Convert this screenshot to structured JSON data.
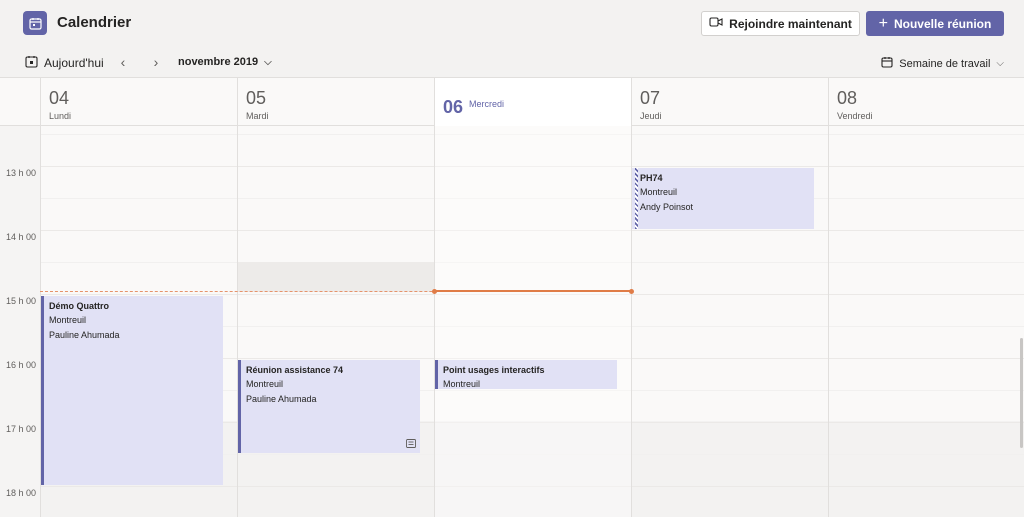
{
  "app": {
    "title": "Calendrier",
    "icon": "calendar-icon"
  },
  "header": {
    "join_label": "Rejoindre maintenant",
    "new_meeting_label": "Nouvelle réunion"
  },
  "toolbar": {
    "today_label": "Aujourd'hui",
    "month_label": "novembre 2019",
    "view_label": "Semaine de travail"
  },
  "days": [
    {
      "num": "04",
      "name": "Lundi"
    },
    {
      "num": "05",
      "name": "Mardi"
    },
    {
      "num": "06",
      "name": "Mercredi"
    },
    {
      "num": "07",
      "name": "Jeudi"
    },
    {
      "num": "08",
      "name": "Vendredi"
    }
  ],
  "times": [
    "13 h 00",
    "14 h 00",
    "15 h 00",
    "16 h 00",
    "17 h 00",
    "18 h 00"
  ],
  "events": {
    "demo": {
      "title": "Démo Quattro",
      "location": "Montreuil",
      "organizer": "Pauline Ahumada"
    },
    "reunion": {
      "title": "Réunion assistance 74",
      "location": "Montreuil",
      "organizer": "Pauline Ahumada"
    },
    "point": {
      "title": "Point usages interactifs",
      "location": "Montreuil"
    },
    "ph74": {
      "title": "PH74",
      "location": "Montreuil",
      "organizer": "Andy Poinsot"
    }
  },
  "colors": {
    "accent": "#6264a7",
    "now": "#e07c47",
    "event_bg": "#e1e1f5"
  }
}
